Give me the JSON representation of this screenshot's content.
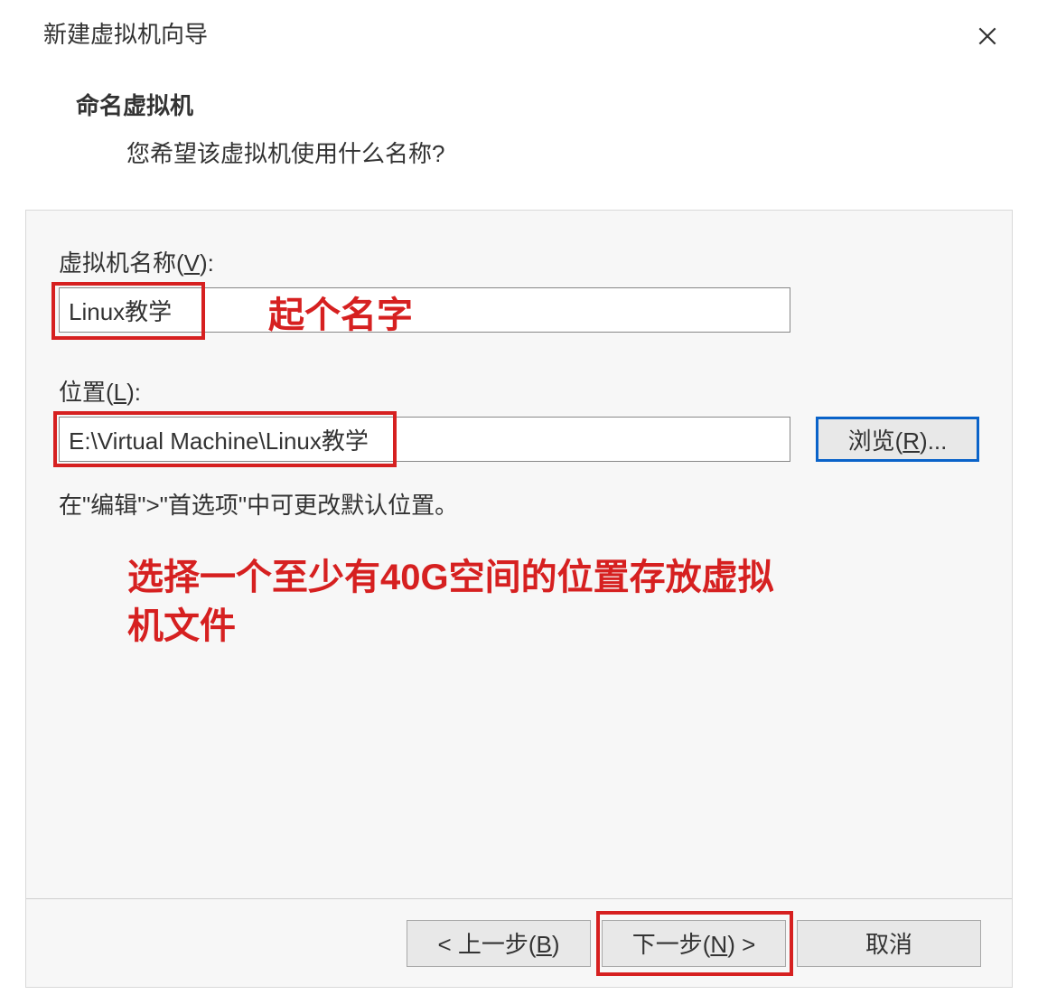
{
  "window": {
    "title": "新建虚拟机向导",
    "subtitle": "命名虚拟机",
    "subdesc": "您希望该虚拟机使用什么名称?"
  },
  "fields": {
    "name_label_prefix": "虚拟机名称(",
    "name_label_key": "V",
    "name_label_suffix": "):",
    "name_value": "Linux教学",
    "location_label_prefix": "位置(",
    "location_label_key": "L",
    "location_label_suffix": "):",
    "location_value": "E:\\Virtual Machine\\Linux教学",
    "browse_prefix": "浏览(",
    "browse_key": "R",
    "browse_suffix": ")...",
    "hint": "在\"编辑\">\"首选项\"中可更改默认位置。"
  },
  "annotations": {
    "name_hint": "起个名字",
    "location_hint": "选择一个至少有40G空间的位置存放虚拟机文件"
  },
  "footer": {
    "back_prefix": "< 上一步(",
    "back_key": "B",
    "back_suffix": ")",
    "next_prefix": "下一步(",
    "next_key": "N",
    "next_suffix": ") >",
    "cancel": "取消"
  }
}
